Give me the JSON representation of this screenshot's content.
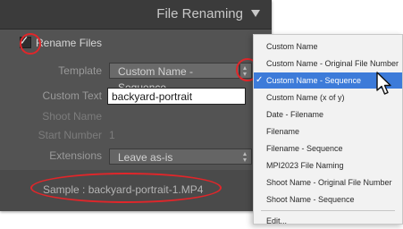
{
  "panel": {
    "title": "File Renaming",
    "rename_files_label": "Rename Files",
    "rename_files_checked": true,
    "template_label": "Template",
    "template_value": "Custom Name - Sequence",
    "custom_text_label": "Custom Text",
    "custom_text_value": "backyard-portrait",
    "shoot_name_label": "Shoot Name",
    "start_number_label": "Start Number",
    "start_number_value": "1",
    "extensions_label": "Extensions",
    "extensions_value": "Leave as-is",
    "sample_text": "Sample :  backyard-portrait-1.MP4"
  },
  "menu": {
    "items": [
      {
        "label": "Custom Name"
      },
      {
        "label": "Custom Name - Original File Number"
      },
      {
        "label": "Custom Name - Sequence",
        "selected": true
      },
      {
        "label": "Custom Name (x of y)"
      },
      {
        "label": "Date - Filename"
      },
      {
        "label": "Filename"
      },
      {
        "label": "Filename - Sequence"
      },
      {
        "label": "MPI2023 File Naming"
      },
      {
        "label": "Shoot Name - Original File Number"
      },
      {
        "label": "Shoot Name - Sequence"
      }
    ],
    "edit_label": "Edit..."
  },
  "colors": {
    "panel_bg": "#535353",
    "header_bg": "#3b3b3b",
    "annotation_red": "#e0262a",
    "menu_selection": "#3d7bd9"
  },
  "icons": {
    "collapse": "triangle-down-icon",
    "select_arrows": "up-down-arrows-icon",
    "checkmark": "checkmark-icon",
    "cursor": "mouse-pointer-icon"
  }
}
